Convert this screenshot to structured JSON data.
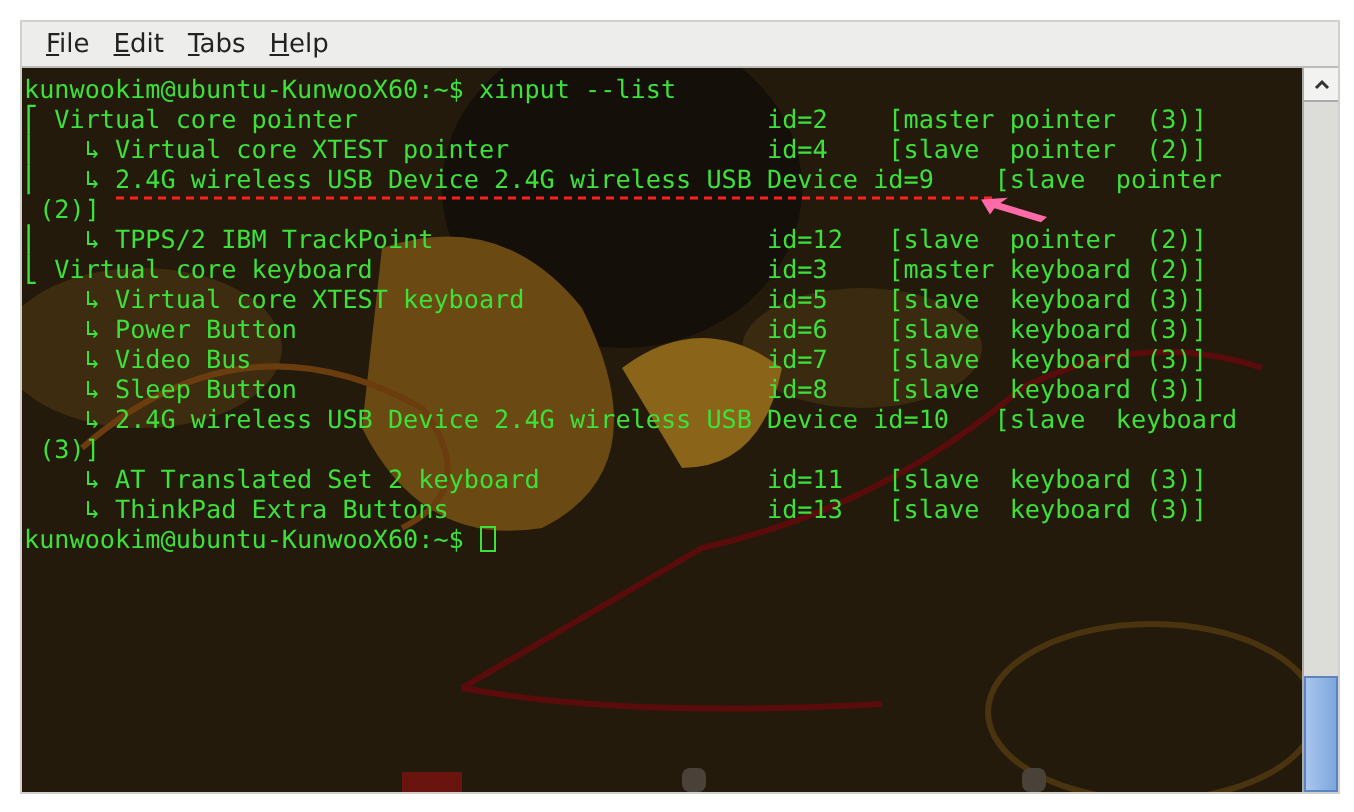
{
  "menu": [
    {
      "label": "File"
    },
    {
      "label": "Edit"
    },
    {
      "label": "Tabs"
    },
    {
      "label": "Help"
    }
  ],
  "terminal": {
    "lines": [
      "kunwookim@ubuntu-KunwooX60:~$ xinput --list",
      "⎡ Virtual core pointer                           id=2    [master pointer  (3)]",
      "⎜   ↳ Virtual core XTEST pointer                 id=4    [slave  pointer  (2)]",
      "⎜   ↳ 2.4G wireless USB Device 2.4G wireless USB Device id=9    [slave  pointer",
      " (2)]",
      "⎜   ↳ TPPS/2 IBM TrackPoint                      id=12   [slave  pointer  (2)]",
      "⎣ Virtual core keyboard                          id=3    [master keyboard (2)]",
      "    ↳ Virtual core XTEST keyboard                id=5    [slave  keyboard (3)]",
      "    ↳ Power Button                               id=6    [slave  keyboard (3)]",
      "    ↳ Video Bus                                  id=7    [slave  keyboard (3)]",
      "    ↳ Sleep Button                               id=8    [slave  keyboard (3)]",
      "    ↳ 2.4G wireless USB Device 2.4G wireless USB Device id=10   [slave  keyboard",
      " (3)]",
      "    ↳ AT Translated Set 2 keyboard               id=11   [slave  keyboard (3)]",
      "    ↳ ThinkPad Extra Buttons                     id=13   [slave  keyboard (3)]"
    ],
    "prompt": "kunwookim@ubuntu-KunwooX60:~$"
  }
}
